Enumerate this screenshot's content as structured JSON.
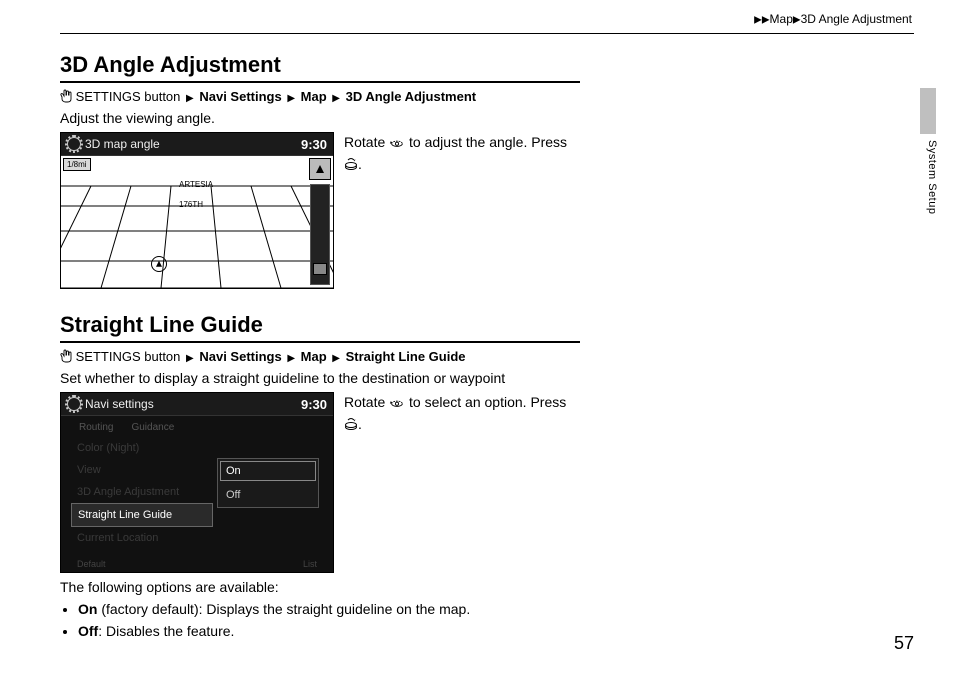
{
  "breadcrumb": {
    "arrows": "▶▶",
    "seg1": "Map",
    "seg2": "3D Angle Adjustment"
  },
  "side_label": "System Setup",
  "page_number": "57",
  "s1": {
    "heading": "3D Angle Adjustment",
    "path": {
      "btn": "SETTINGS button",
      "a": "Navi Settings",
      "b": "Map",
      "c": "3D Angle Adjustment"
    },
    "desc": "Adjust the viewing angle.",
    "instr_a": "Rotate ",
    "instr_b": " to adjust the angle. Press ",
    "instr_c": ".",
    "screen": {
      "title": "3D map angle",
      "clock": "9:30",
      "scale": "1/8mi",
      "street1": "ARTESIA",
      "street2": "176TH"
    }
  },
  "s2": {
    "heading": "Straight Line Guide",
    "path": {
      "btn": "SETTINGS button",
      "a": "Navi Settings",
      "b": "Map",
      "c": "Straight Line Guide"
    },
    "desc": "Set whether to display a straight guideline to the destination or waypoint",
    "instr_a": "Rotate ",
    "instr_b": " to select an option. Press ",
    "instr_c": ".",
    "screen": {
      "title": "Navi settings",
      "clock": "9:30",
      "tabs": {
        "a": "Routing",
        "b": "Guidance"
      },
      "items": {
        "i1": "Color (Night)",
        "i2": "View",
        "i3": "3D Angle Adjustment",
        "i4": "Straight Line Guide",
        "i5": "Current Location"
      },
      "opt_on": "On",
      "opt_off": "Off",
      "footer_l": "Default",
      "footer_r": "List"
    },
    "options_intro": "The following options are available:",
    "opt_on_label": "On",
    "opt_on_text": " (factory default): Displays the straight guideline on the map.",
    "opt_off_label": "Off",
    "opt_off_text": ": Disables the feature."
  }
}
